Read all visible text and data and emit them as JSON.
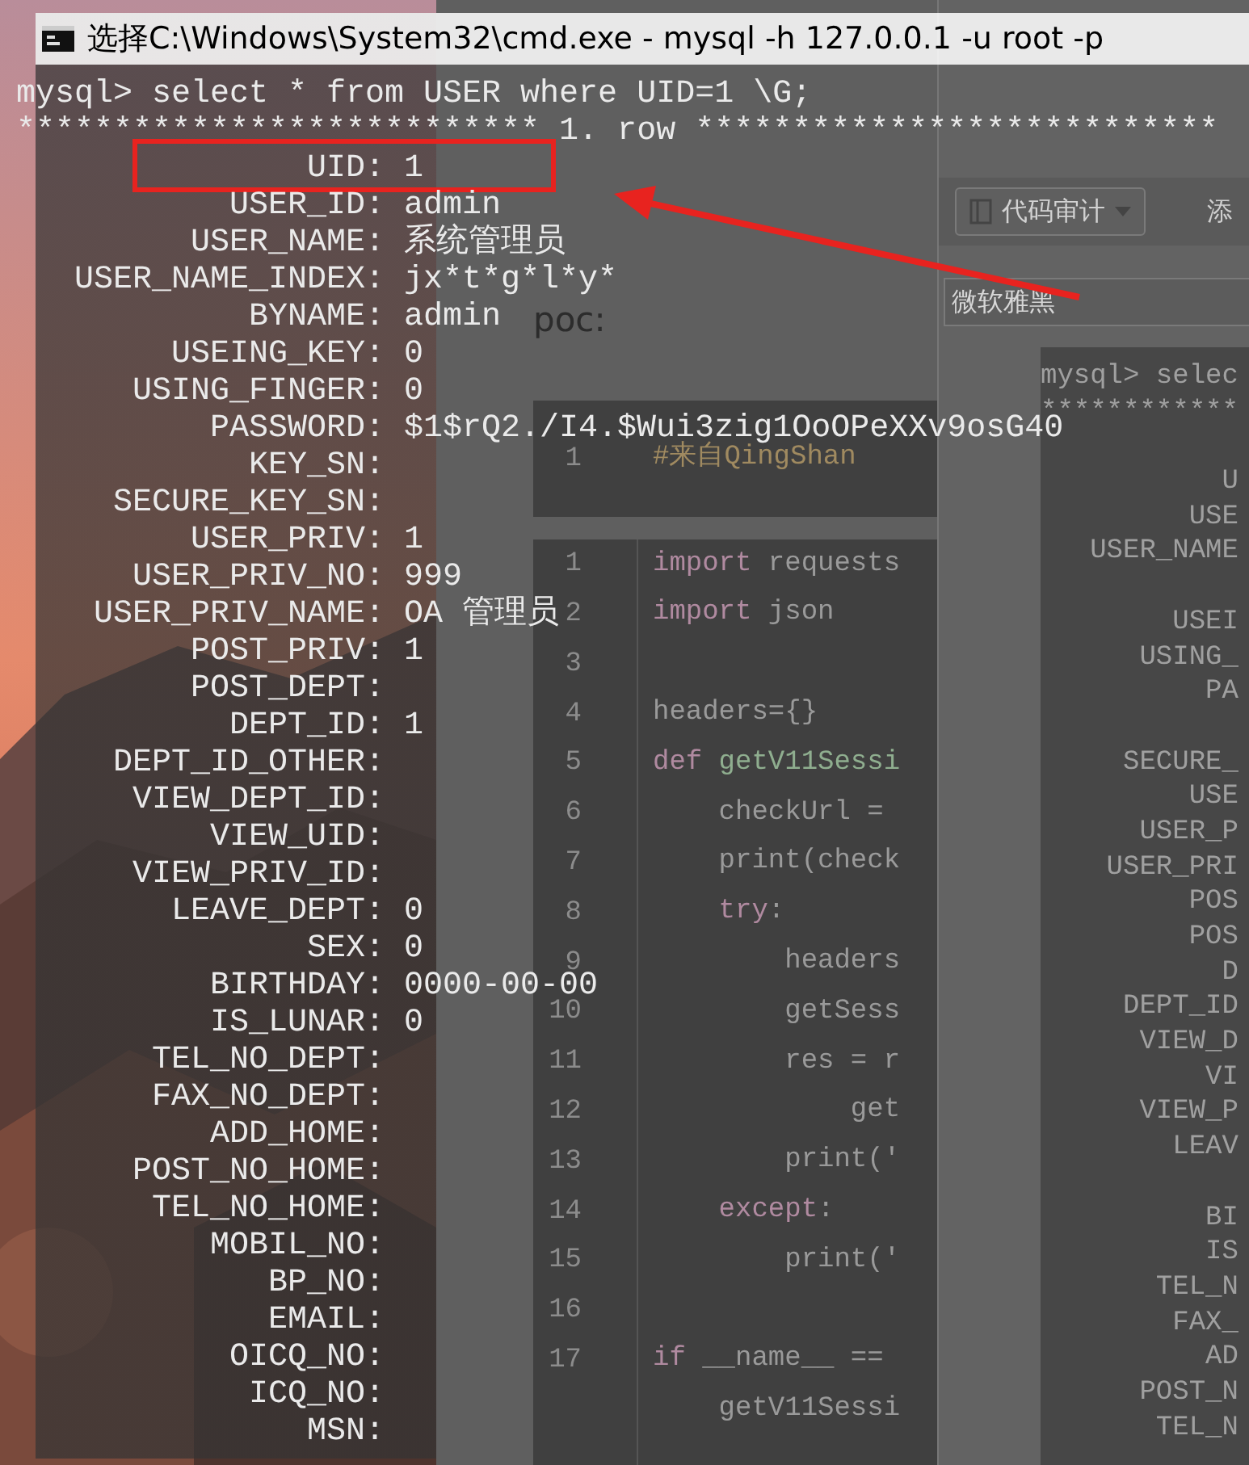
{
  "background": {
    "browser": {
      "poc_text": "poc:",
      "code_header": {
        "number": "1",
        "text": "#来自QingShan"
      },
      "code_lines": [
        {
          "number": "1",
          "tokens": [
            {
              "text": "import",
              "kind": "keyword"
            },
            {
              "text": " requests",
              "kind": "plain"
            }
          ]
        },
        {
          "number": "2",
          "tokens": [
            {
              "text": "import",
              "kind": "keyword"
            },
            {
              "text": " json",
              "kind": "plain"
            }
          ]
        },
        {
          "number": "3"
        },
        {
          "number": "4",
          "tokens": [
            {
              "text": "headers={}",
              "kind": "plain"
            }
          ]
        },
        {
          "number": "5",
          "tokens": [
            {
              "text": "def",
              "kind": "keyword"
            },
            {
              "text": " getV11Sessi",
              "kind": "function"
            }
          ]
        },
        {
          "number": "6",
          "tokens": [
            {
              "text": "    checkUrl =",
              "kind": "plain"
            }
          ]
        },
        {
          "number": "7",
          "tokens": [
            {
              "text": "    print(check",
              "kind": "plain"
            }
          ]
        },
        {
          "number": "8",
          "tokens": [
            {
              "text": "    try",
              "kind": "keyword"
            },
            {
              "text": ":",
              "kind": "plain"
            }
          ]
        },
        {
          "number": "9",
          "tokens": [
            {
              "text": "        headers",
              "kind": "plain"
            }
          ]
        },
        {
          "number": "10",
          "tokens": [
            {
              "text": "        getSess",
              "kind": "plain"
            }
          ]
        },
        {
          "number": "11",
          "tokens": [
            {
              "text": "        res = r",
              "kind": "plain"
            }
          ]
        },
        {
          "number": "12",
          "tokens": [
            {
              "text": "            get",
              "kind": "plain"
            }
          ]
        },
        {
          "number": "13",
          "tokens": [
            {
              "text": "        print('",
              "kind": "plain"
            }
          ]
        },
        {
          "number": "14",
          "tokens": [
            {
              "text": "    except",
              "kind": "keyword"
            },
            {
              "text": ":",
              "kind": "plain"
            }
          ]
        },
        {
          "number": "15",
          "tokens": [
            {
              "text": "        print('",
              "kind": "plain"
            }
          ]
        },
        {
          "number": "16"
        },
        {
          "number": "17",
          "tokens": [
            {
              "text": "if",
              "kind": "keyword"
            },
            {
              "text": " __name__ ==",
              "kind": "plain"
            }
          ]
        },
        {
          "tokens": [
            {
              "text": "    getV11Sessi",
              "kind": "plain"
            }
          ]
        }
      ]
    },
    "editor": {
      "dropdown": "代码审计",
      "add_text": "添",
      "font_field": "微软雅黑",
      "inner_console": [
        {
          "kind": "text",
          "text": "mysql> selec"
        },
        {
          "kind": "text",
          "text": "************"
        },
        {
          "kind": "blank"
        },
        {
          "kind": "text",
          "text": "           U"
        },
        {
          "kind": "text",
          "text": "         USE"
        },
        {
          "kind": "text",
          "text": "   USER_NAME"
        },
        {
          "kind": "blank"
        },
        {
          "kind": "text",
          "text": "        USEI"
        },
        {
          "kind": "text",
          "text": "      USING_"
        },
        {
          "kind": "text",
          "text": "          PA"
        },
        {
          "kind": "blank"
        },
        {
          "kind": "text",
          "text": "     SECURE_"
        },
        {
          "kind": "text",
          "text": "         USE"
        },
        {
          "kind": "text",
          "text": "      USER_P"
        },
        {
          "kind": "text",
          "text": "    USER_PRI"
        },
        {
          "kind": "text",
          "text": "         POS"
        },
        {
          "kind": "text",
          "text": "         POS"
        },
        {
          "kind": "text",
          "text": "           D"
        },
        {
          "kind": "text",
          "text": "     DEPT_ID"
        },
        {
          "kind": "text",
          "text": "      VIEW_D"
        },
        {
          "kind": "text",
          "text": "          VI"
        },
        {
          "kind": "text",
          "text": "      VIEW_P"
        },
        {
          "kind": "text",
          "text": "        LEAV"
        },
        {
          "kind": "blank"
        },
        {
          "kind": "text",
          "text": "          BI"
        },
        {
          "kind": "text",
          "text": "          IS"
        },
        {
          "kind": "text",
          "text": "       TEL_N"
        },
        {
          "kind": "text",
          "text": "        FAX_"
        },
        {
          "kind": "text",
          "text": "          AD"
        },
        {
          "kind": "text",
          "text": "      POST_N"
        },
        {
          "kind": "text",
          "text": "       TEL_N"
        }
      ]
    }
  },
  "cmd_window": {
    "title": "选择C:\\Windows\\System32\\cmd.exe - mysql  -h 127.0.0.1 -u root -p",
    "command": "mysql> select * from USER where UID=1 \\G;",
    "row_header": "*************************** 1. row ***************************",
    "fields": [
      {
        "name": "UID:",
        "value": "1",
        "highlighted": true
      },
      {
        "name": "USER_ID:",
        "value": "admin",
        "highlighted": false
      },
      {
        "name": "USER_NAME:",
        "value": "系统管理员",
        "highlighted": false
      },
      {
        "name": "USER_NAME_INDEX:",
        "value": "jx*t*g*l*y*",
        "highlighted": false
      },
      {
        "name": "BYNAME:",
        "value": "admin",
        "highlighted": false
      },
      {
        "name": "USEING_KEY:",
        "value": "0",
        "highlighted": false
      },
      {
        "name": "USING_FINGER:",
        "value": "0",
        "highlighted": false
      },
      {
        "name": "PASSWORD:",
        "value": "$1$rQ2./I4.$Wui3zig1OoOPeXXv9osG40",
        "highlighted": false
      },
      {
        "name": "KEY_SN:",
        "highlighted": false
      },
      {
        "name": "SECURE_KEY_SN:",
        "highlighted": false
      },
      {
        "name": "USER_PRIV:",
        "value": "1",
        "highlighted": false
      },
      {
        "name": "USER_PRIV_NO:",
        "value": "999",
        "highlighted": false
      },
      {
        "name": "USER_PRIV_NAME:",
        "value": "OA 管理员",
        "highlighted": false
      },
      {
        "name": "POST_PRIV:",
        "value": "1",
        "highlighted": false
      },
      {
        "name": "POST_DEPT:",
        "highlighted": false
      },
      {
        "name": "DEPT_ID:",
        "value": "1",
        "highlighted": false
      },
      {
        "name": "DEPT_ID_OTHER:",
        "highlighted": false
      },
      {
        "name": "VIEW_DEPT_ID:",
        "highlighted": false
      },
      {
        "name": "VIEW_UID:",
        "highlighted": false
      },
      {
        "name": "VIEW_PRIV_ID:",
        "highlighted": false
      },
      {
        "name": "LEAVE_DEPT:",
        "value": "0",
        "highlighted": false
      },
      {
        "name": "SEX:",
        "value": "0",
        "highlighted": false
      },
      {
        "name": "BIRTHDAY:",
        "value": "0000-00-00",
        "highlighted": false
      },
      {
        "name": "IS_LUNAR:",
        "value": "0",
        "highlighted": false
      },
      {
        "name": "TEL_NO_DEPT:",
        "highlighted": false
      },
      {
        "name": "FAX_NO_DEPT:",
        "highlighted": false
      },
      {
        "name": "ADD_HOME:",
        "highlighted": false
      },
      {
        "name": "POST_NO_HOME:",
        "highlighted": false
      },
      {
        "name": "TEL_NO_HOME:",
        "highlighted": false
      },
      {
        "name": "MOBIL_NO:",
        "highlighted": false
      },
      {
        "name": "BP_NO:",
        "highlighted": false
      },
      {
        "name": "EMAIL:",
        "highlighted": false
      },
      {
        "name": "OICQ_NO:",
        "highlighted": false
      },
      {
        "name": "ICQ_NO:",
        "highlighted": false
      },
      {
        "name": "MSN:",
        "highlighted": false
      }
    ]
  }
}
